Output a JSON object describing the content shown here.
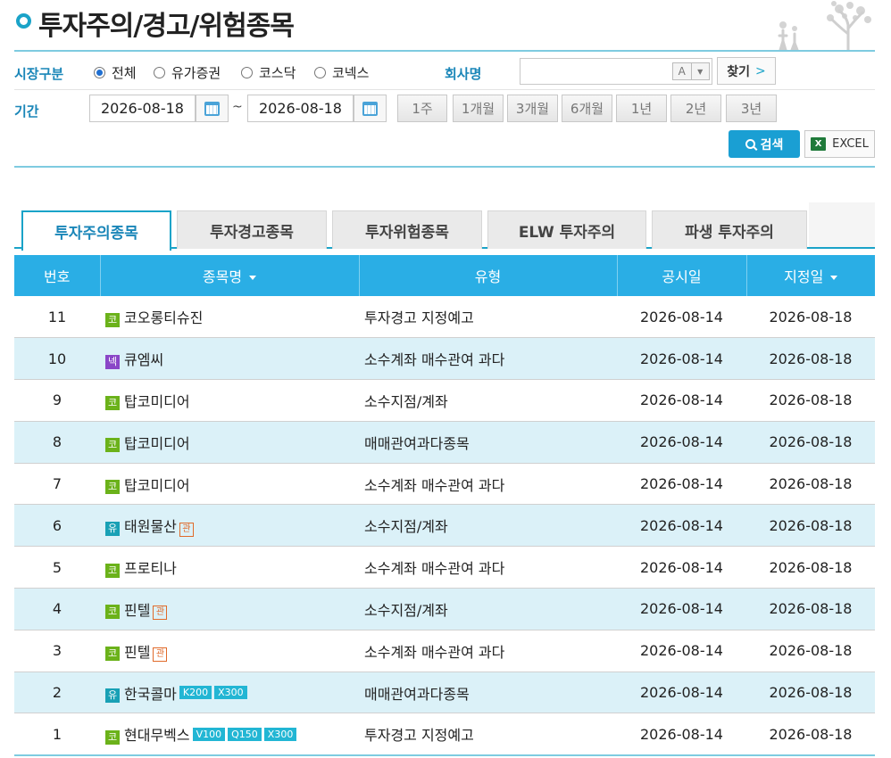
{
  "header": {
    "title": "투자주의/경고/위험종목"
  },
  "filter": {
    "market_label": "시장구분",
    "market_options": [
      {
        "label": "전체",
        "selected": true
      },
      {
        "label": "유가증권",
        "selected": false
      },
      {
        "label": "코스닥",
        "selected": false
      },
      {
        "label": "코넥스",
        "selected": false
      }
    ],
    "company_label": "회사명",
    "company_value": "",
    "autocomplete_label": "A",
    "find_label": "찾기",
    "find_arrow": ">",
    "period_label": "기간",
    "date_from": "2026-08-18",
    "date_to": "2026-08-18",
    "date_separator": "~",
    "period_buttons": [
      "1주",
      "1개월",
      "3개월",
      "6개월",
      "1년",
      "2년",
      "3년"
    ],
    "search_label": "검색",
    "excel_label": "EXCEL"
  },
  "tabs": [
    {
      "label": "투자주의종목",
      "active": true
    },
    {
      "label": "투자경고종목",
      "active": false
    },
    {
      "label": "투자위험종목",
      "active": false
    },
    {
      "label": "ELW 투자주의",
      "active": false
    },
    {
      "label": "파생 투자주의",
      "active": false
    }
  ],
  "table": {
    "headers": {
      "no": "번호",
      "name": "종목명",
      "type": "유형",
      "announce": "공시일",
      "designate": "지정일"
    },
    "rows": [
      {
        "no": "11",
        "market": "코",
        "name": "코오롱티슈진",
        "flags": [],
        "indexes": [],
        "type": "투자경고 지정예고",
        "announce": "2026-08-14",
        "designate": "2026-08-18"
      },
      {
        "no": "10",
        "market": "넥",
        "name": "큐엠씨",
        "flags": [],
        "indexes": [],
        "type": "소수계좌 매수관여 과다",
        "announce": "2026-08-14",
        "designate": "2026-08-18"
      },
      {
        "no": "9",
        "market": "코",
        "name": "탑코미디어",
        "flags": [],
        "indexes": [],
        "type": "소수지점/계좌",
        "announce": "2026-08-14",
        "designate": "2026-08-18"
      },
      {
        "no": "8",
        "market": "코",
        "name": "탑코미디어",
        "flags": [],
        "indexes": [],
        "type": "매매관여과다종목",
        "announce": "2026-08-14",
        "designate": "2026-08-18"
      },
      {
        "no": "7",
        "market": "코",
        "name": "탑코미디어",
        "flags": [],
        "indexes": [],
        "type": "소수계좌 매수관여 과다",
        "announce": "2026-08-14",
        "designate": "2026-08-18"
      },
      {
        "no": "6",
        "market": "유",
        "name": "태원물산",
        "flags": [
          "관"
        ],
        "indexes": [],
        "type": "소수지점/계좌",
        "announce": "2026-08-14",
        "designate": "2026-08-18"
      },
      {
        "no": "5",
        "market": "코",
        "name": "프로티나",
        "flags": [],
        "indexes": [],
        "type": "소수계좌 매수관여 과다",
        "announce": "2026-08-14",
        "designate": "2026-08-18"
      },
      {
        "no": "4",
        "market": "코",
        "name": "핀텔",
        "flags": [
          "관"
        ],
        "indexes": [],
        "type": "소수지점/계좌",
        "announce": "2026-08-14",
        "designate": "2026-08-18"
      },
      {
        "no": "3",
        "market": "코",
        "name": "핀텔",
        "flags": [
          "관"
        ],
        "indexes": [],
        "type": "소수계좌 매수관여 과다",
        "announce": "2026-08-14",
        "designate": "2026-08-18"
      },
      {
        "no": "2",
        "market": "유",
        "name": "한국콜마",
        "flags": [],
        "indexes": [
          "K200",
          "X300"
        ],
        "type": "매매관여과다종목",
        "announce": "2026-08-14",
        "designate": "2026-08-18"
      },
      {
        "no": "1",
        "market": "코",
        "name": "현대무벡스",
        "flags": [],
        "indexes": [
          "V100",
          "Q150",
          "X300"
        ],
        "type": "투자경고 지정예고",
        "announce": "2026-08-14",
        "designate": "2026-08-18"
      }
    ]
  },
  "colors": {
    "accent": "#1aa3c8",
    "header_bg": "#2aaee5",
    "alt_row": "#dbf1f8",
    "kosdaq": "#6bb21a",
    "konex": "#8a46c7",
    "kospi": "#18a0b5",
    "flag": "#e06a2a"
  }
}
